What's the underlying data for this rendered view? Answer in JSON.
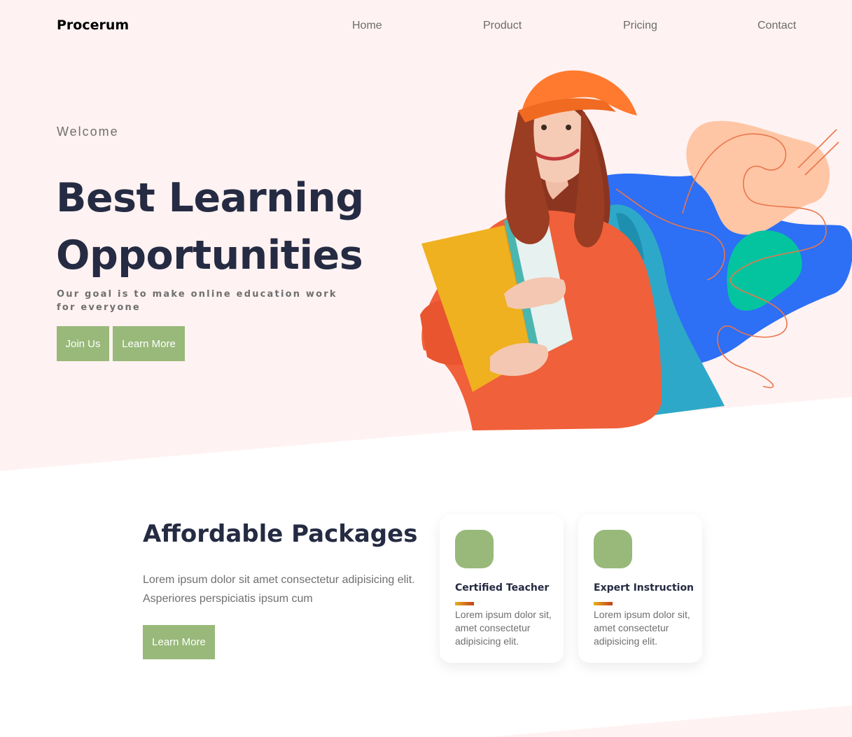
{
  "brand": "Procerum",
  "nav": {
    "items": [
      {
        "label": "Home"
      },
      {
        "label": "Product"
      },
      {
        "label": "Pricing"
      },
      {
        "label": "Contact"
      }
    ]
  },
  "hero": {
    "eyebrow": "Welcome",
    "title_line1": "Best Learning",
    "title_line2": "Opportunities",
    "subtitle": "Our goal is to make online education work for everyone",
    "primary_button": "Join Us",
    "secondary_button": "Learn More"
  },
  "packages": {
    "title": "Affordable Packages",
    "description": "Lorem ipsum dolor sit amet consectetur adipisicing elit. Asperiores perspiciatis ipsum cum",
    "button": "Learn More",
    "cards": [
      {
        "title": "Certified Teacher",
        "text": "Lorem ipsum dolor sit, amet consectetur adipisicing elit."
      },
      {
        "title": "Expert Instruction",
        "text": "Lorem ipsum dolor sit, amet consectetur adipisicing elit."
      }
    ]
  },
  "colors": {
    "hero_background": "#fff2f2",
    "heading": "#252b42",
    "accent_green": "#98b97a",
    "blob_blue": "#2d6ff5",
    "blob_peach": "#ffc6a5",
    "blob_teal": "#04c4a0",
    "sweater_orange": "#f0603a"
  },
  "icons": {
    "hero_illustration": "student-with-books-illustration"
  }
}
